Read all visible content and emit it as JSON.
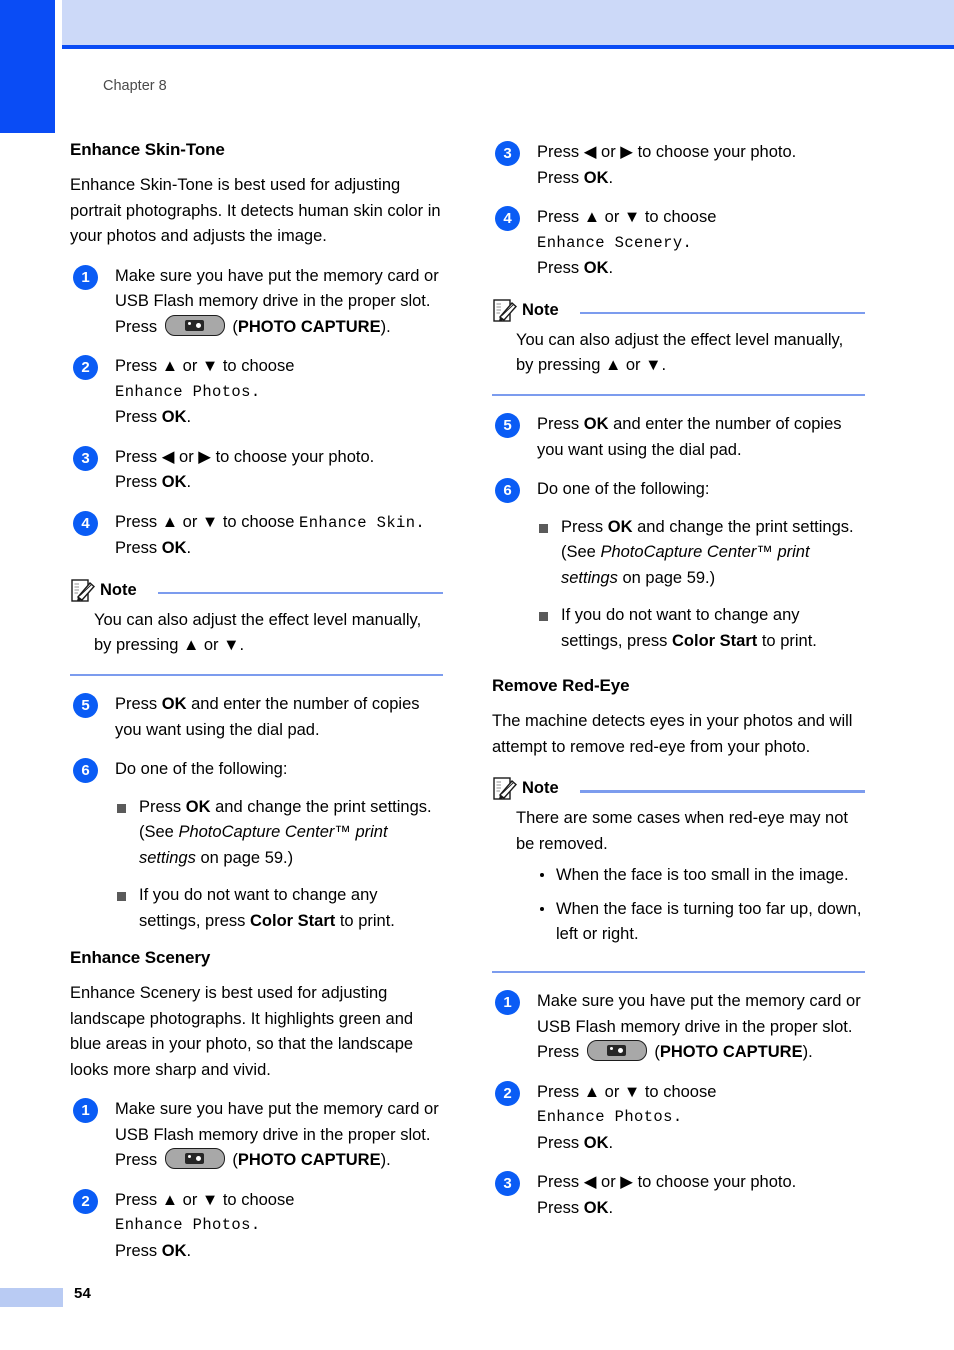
{
  "page": {
    "chapter_label": "Chapter 8",
    "page_number": "54",
    "accent_blue": "#0a4cf5",
    "header_band_color": "#ccd9f8",
    "note_rule_color": "#7c9cee",
    "step_badge_color": "#0a5cf5"
  },
  "icons": {
    "photo_capture_button": "photo-capture-button-icon",
    "note": "note-pencil-icon"
  },
  "labels": {
    "press": "Press",
    "or": "or",
    "to_choose": "to choose",
    "ok": "OK",
    "photo_capture": "PHOTO CAPTURE",
    "color_start": "Color Start",
    "note": "Note",
    "up_arrow": "▲",
    "down_arrow": "▼",
    "left_arrow": "◀",
    "right_arrow": "▶",
    "period": ".",
    "open_paren": "(",
    "close_paren": ").",
    "press_ok_period": "Press OK."
  },
  "sections": {
    "enhance_skin_tone": {
      "title": "Enhance Skin-Tone",
      "intro": "Enhance Skin-Tone is best used for adjusting portrait photographs. It detects human skin color in your photos and adjusts the image.",
      "step1_text": "Make sure you have put the memory card or USB Flash memory drive in the proper slot.",
      "step2_prefix": "Press ▲ or ▼ to choose",
      "step2_mono": "Enhance Photos.",
      "step3_text": "Press ◀ or ▶ to choose your photo.",
      "step4_prefix": "Press ▲ or ▼ to choose",
      "step4_mono": "Enhance Skin.",
      "note_text": "You can also adjust the effect level manually, by pressing ▲ or ▼.",
      "step5_text": "and enter the number of copies you want using the dial pad.",
      "step6_text": "Do one of the following:",
      "bullet1_a": "and change the print settings. (See",
      "bullet1_italic": "PhotoCapture Center™ print settings",
      "bullet1_b": "on page 59.)",
      "bullet2_a": "If you do not want to change any settings, press",
      "bullet2_b": "to print."
    },
    "enhance_scenery": {
      "title": "Enhance Scenery",
      "intro": "Enhance Scenery is best used for adjusting landscape photographs. It highlights green and blue areas in your photo, so that the landscape looks more sharp and vivid.",
      "step1_text": "Make sure you have put the memory card or USB Flash memory drive in the proper slot.",
      "step2_prefix": "Press ▲ or ▼ to choose",
      "step2_mono": "Enhance Photos.",
      "step3_text": "Press ◀ or ▶ to choose your photo.",
      "step4_prefix": "Press ▲ or ▼ to choose",
      "step4_mono": "Enhance Scenery.",
      "note_text": "You can also adjust the effect level manually, by pressing ▲ or ▼.",
      "step5_text": "and enter the number of copies you want using the dial pad.",
      "step6_text": "Do one of the following:",
      "bullet1_a": "and change the print settings. (See",
      "bullet1_italic": "PhotoCapture Center™ print settings",
      "bullet1_b": "on page 59.)",
      "bullet2_a": "If you do not want to change any settings, press",
      "bullet2_b": "to print."
    },
    "remove_red_eye": {
      "title": "Remove Red-Eye",
      "intro": "The machine detects eyes in your photos and will attempt to remove red-eye from your photo.",
      "note_text": "There are some cases when red-eye may not be removed.",
      "note_bullet1": "When the face is too small in the image.",
      "note_bullet2": "When the face is turning too far up, down, left or right.",
      "step1_text": "Make sure you have put the memory card or USB Flash memory drive in the proper slot.",
      "step2_prefix": "Press ▲ or ▼ to choose",
      "step2_mono": "Enhance Photos.",
      "step3_text": "Press ◀ or ▶ to choose your photo."
    }
  },
  "step_numbers": {
    "n1": "1",
    "n2": "2",
    "n3": "3",
    "n4": "4",
    "n5": "5",
    "n6": "6"
  }
}
